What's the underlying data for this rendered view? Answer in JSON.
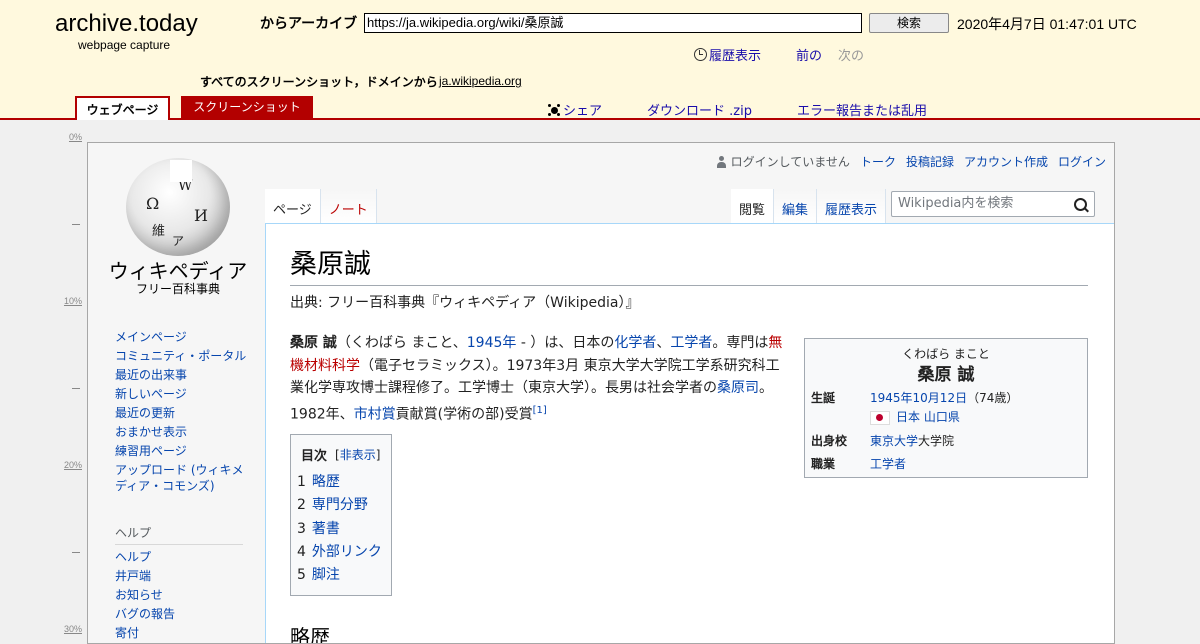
{
  "archive": {
    "brand": "archive.today",
    "brand_sub": "webpage capture",
    "archive_label": "からアーカイブ",
    "url": "https://ja.wikipedia.org/wiki/桑原誠",
    "search_button": "検索",
    "capture_date": "2020年4月7日 01:47:01 UTC",
    "history": "履歴表示",
    "prev": "前の",
    "next": "次の",
    "all_screenshots": "すべてのスクリーンショット，ドメインから",
    "domain": "ja.wikipedia.org",
    "tab_webpage": "ウェブページ",
    "tab_screenshot": "スクリーンショット",
    "share": "シェア",
    "download": "ダウンロード .zip",
    "report": "エラー報告または乱用"
  },
  "ruler": {
    "labels": [
      "0%",
      "10%",
      "20%",
      "30%"
    ]
  },
  "wiki": {
    "logo_name": "ウィキペディア",
    "logo_tagline": "フリー百科事典",
    "nav": [
      "メインページ",
      "コミュニティ・ポータル",
      "最近の出来事",
      "新しいページ",
      "最近の更新",
      "おまかせ表示",
      "練習用ページ",
      "アップロード (ウィキメディア・コモンズ)"
    ],
    "help_heading": "ヘルプ",
    "help": [
      "ヘルプ",
      "井戸端",
      "お知らせ",
      "バグの報告",
      "寄付"
    ],
    "personal": {
      "not_logged_in": "ログインしていません",
      "talk": "トーク",
      "contributions": "投稿記録",
      "create_account": "アカウント作成",
      "login": "ログイン"
    },
    "tabs": {
      "page": "ページ",
      "note": "ノート",
      "read": "閲覧",
      "edit": "編集",
      "history": "履歴表示"
    },
    "search_placeholder": "Wikipedia内を検索",
    "title": "桑原誠",
    "from": "出典: フリー百科事典『ウィキペディア（Wikipedia）』",
    "lead": {
      "name_bold": "桑原 誠",
      "t1": "（くわばら まこと、",
      "l1": "1945年",
      "t2": " - ）は、日本の",
      "l2": "化学者",
      "t3": "、",
      "l3": "工学者",
      "t4": "。専門は",
      "l4": "無機材料科学",
      "t5": "（電子セラミックス）。1973年3月 東京大学大学院工学系研究科工業化学専攻博士課程修了。工学博士（東京大学）。長男は社会学者の",
      "l5": "桑原司",
      "t6": "。1982年、",
      "l6": "市村賞",
      "t7": "貢献賞(学術の部)受賞",
      "ref": "[1]"
    },
    "infobox": {
      "ruby": "くわばら まこと",
      "name": "桑原 誠",
      "birth_label": "生誕",
      "birth_date": "1945年10月12日",
      "birth_age": "（74歳）",
      "birth_country": "日本",
      "birth_pref": "山口県",
      "school_label": "出身校",
      "school_link": "東京大学",
      "school_rest": "大学院",
      "job_label": "職業",
      "job": "工学者"
    },
    "toc": {
      "title": "目次",
      "hide": "非表示",
      "items": [
        {
          "num": "1",
          "label": "略歴"
        },
        {
          "num": "2",
          "label": "専門分野"
        },
        {
          "num": "3",
          "label": "著書"
        },
        {
          "num": "4",
          "label": "外部リンク"
        },
        {
          "num": "5",
          "label": "脚注"
        }
      ]
    },
    "section1": "略歴"
  }
}
